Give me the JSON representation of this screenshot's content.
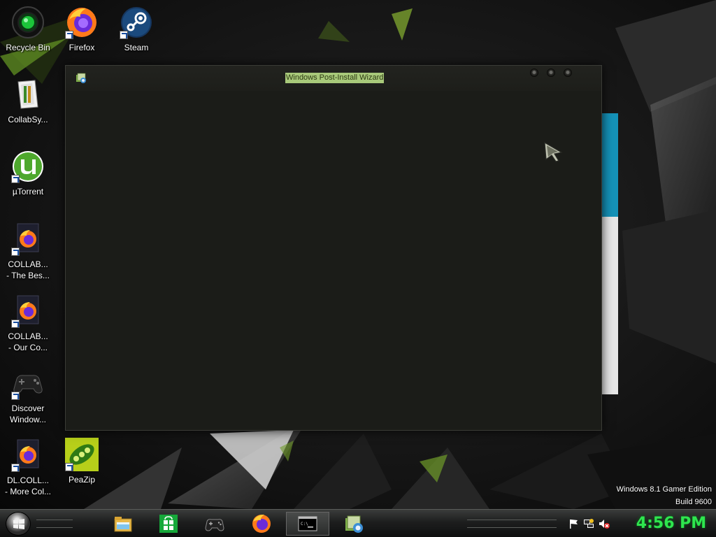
{
  "desktop": {
    "icons": [
      {
        "id": "recycle-bin",
        "label": "Recycle Bin"
      },
      {
        "id": "firefox",
        "label": "Firefox"
      },
      {
        "id": "steam",
        "label": "Steam"
      },
      {
        "id": "collabsy",
        "label": "CollabSy..."
      },
      {
        "id": "utorrent",
        "label": "µTorrent"
      },
      {
        "id": "collab-best",
        "label_line1": "COLLAB...",
        "label_line2": "- The Bes..."
      },
      {
        "id": "collab-our",
        "label_line1": "COLLAB...",
        "label_line2": "- Our Co..."
      },
      {
        "id": "discover",
        "label_line1": "Discover",
        "label_line2": "Window..."
      },
      {
        "id": "dl-collab",
        "label_line1": "DL.COLL...",
        "label_line2": "- More Col..."
      },
      {
        "id": "peazip",
        "label": "PeaZip"
      }
    ],
    "edition": {
      "line1": "Windows 8.1 Gamer Edition",
      "line2": "Build 9600"
    }
  },
  "wizard": {
    "title": "Windows Post-Install Wizard"
  },
  "taskbar": {
    "buttons": [
      "file-explorer",
      "store",
      "gamepad",
      "firefox",
      "command-prompt",
      "post-install-wizard"
    ],
    "active": "command-prompt",
    "tray_icons": [
      "action-center-flag-icon",
      "network-icon",
      "volume-muted-icon"
    ],
    "clock": "4:56 PM"
  },
  "colors": {
    "clock": "#2ee64e",
    "wizard_background": "#1b1c18",
    "title_highlight": "#a8c97a",
    "back_window_accent": "#1592b8"
  }
}
